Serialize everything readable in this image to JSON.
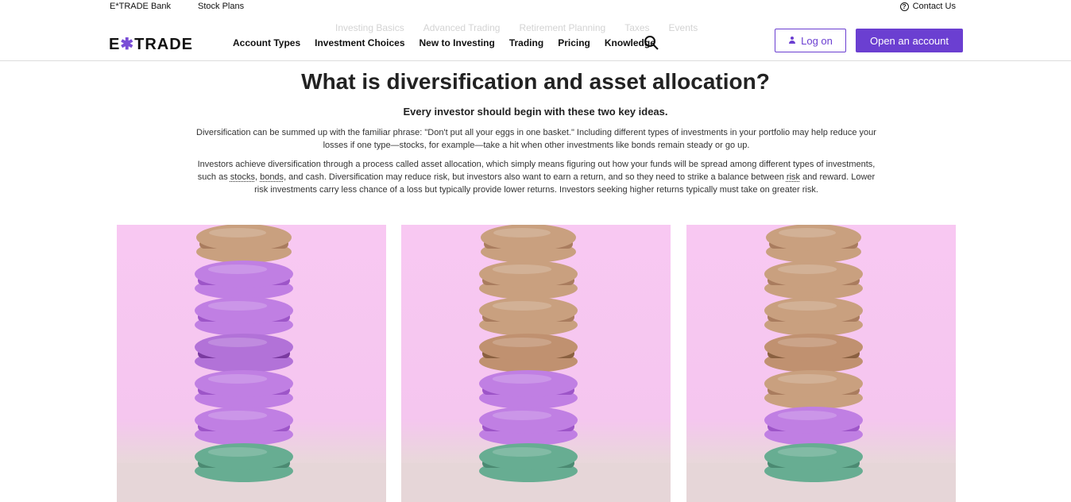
{
  "utility": {
    "bank": "E*TRADE Bank",
    "stock_plans": "Stock Plans",
    "contact": "Contact Us"
  },
  "ghost_nav": [
    "Investing Basics",
    "Advanced Trading",
    "Retirement Planning",
    "Taxes",
    "Events"
  ],
  "logo": {
    "pre": "E",
    "star": "✱",
    "post": "TRADE"
  },
  "nav": {
    "items": [
      "Account Types",
      "Investment Choices",
      "New to Investing",
      "Trading",
      "Pricing",
      "Knowledge"
    ]
  },
  "buttons": {
    "logon": "Log on",
    "open": "Open an account"
  },
  "article": {
    "title": "What is diversification and asset allocation?",
    "subtitle": "Every investor should begin with these two key ideas.",
    "p1": "Diversification can be summed up with the familiar phrase: \"Don't put all your eggs in one basket.\" Including different types of investments in your portfolio may help reduce your losses if one type—stocks, for example—take a hit when other investments like bonds remain steady or go up.",
    "p2_a": "Investors achieve diversification through a process called asset allocation, which simply means figuring out how your funds will be spread among different types of investments, such as ",
    "p2_stocks": "stocks",
    "p2_b": ", ",
    "p2_bonds": "bonds",
    "p2_c": ", and cash. Diversification may reduce risk, but investors also want to earn a return, and so they need to strike a balance between ",
    "p2_risk": "risk",
    "p2_d": " and reward. Lower risk investments carry less chance of a loss but typically provide lower returns. Investors seeking higher returns typically must take on greater risk."
  },
  "images": [
    {
      "stack": [
        "tan",
        "purple",
        "purple",
        "purple-dark",
        "purple",
        "purple",
        "teal"
      ]
    },
    {
      "stack": [
        "tan",
        "tan",
        "tan",
        "tan-dark",
        "purple",
        "purple",
        "teal"
      ]
    },
    {
      "stack": [
        "tan",
        "tan",
        "tan",
        "tan-dark",
        "tan",
        "purple",
        "teal"
      ]
    }
  ],
  "colors": {
    "accent": "#6b3fd1",
    "tan": "#c79a78",
    "purple": "#b66fdb",
    "teal": "#5fa88c",
    "bg": "#f8c8f2"
  }
}
